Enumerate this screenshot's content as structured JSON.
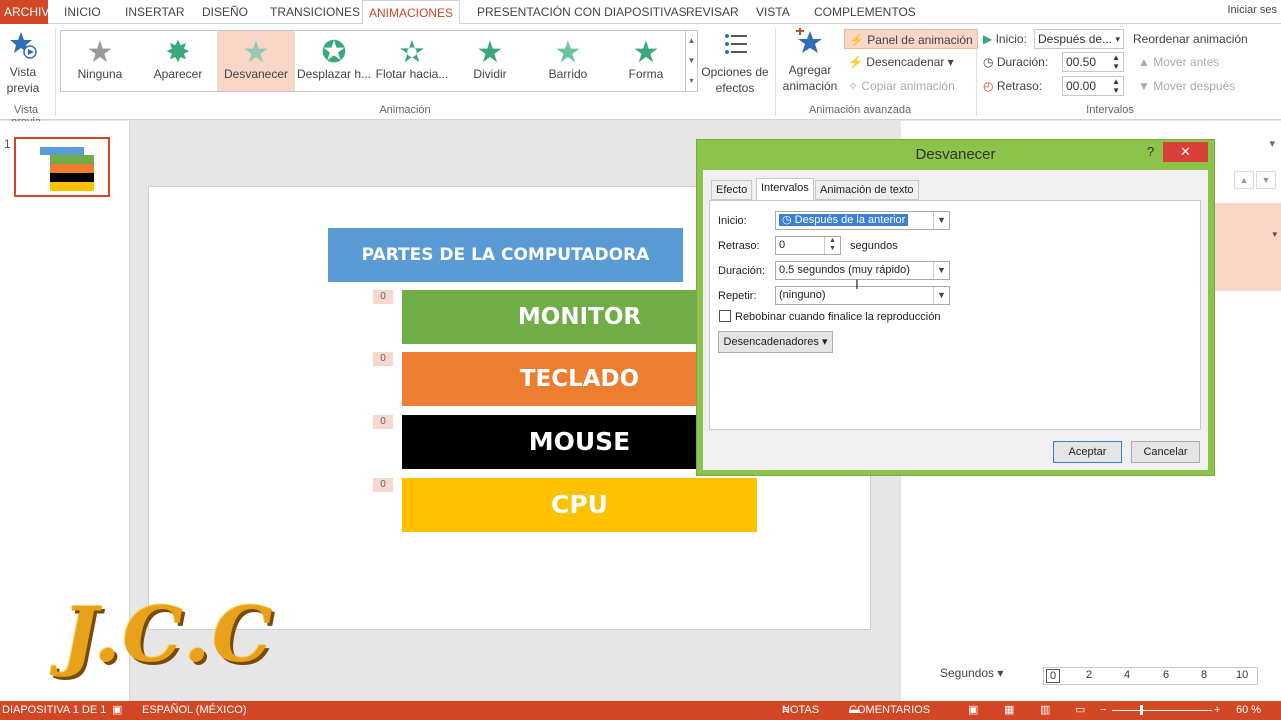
{
  "tabs": [
    "ARCHIVO",
    "INICIO",
    "INSERTAR",
    "DISEÑO",
    "TRANSICIONES",
    "ANIMACIONES",
    "PRESENTACIÓN CON DIAPOSITIVAS",
    "REVISAR",
    "VISTA",
    "COMPLEMENTOS"
  ],
  "signin": "Iniciar ses",
  "ribbon": {
    "preview_label_1": "Vista",
    "preview_label_2": "previa",
    "preview_group": "Vista previa",
    "gallery": [
      "Ninguna",
      "Aparecer",
      "Desvanecer",
      "Desplazar h...",
      "Flotar hacia...",
      "Dividir",
      "Barrido",
      "Forma"
    ],
    "effects_1": "Opciones de",
    "effects_2": "efectos",
    "anim_group": "Animación",
    "add_1": "Agregar",
    "add_2": "animación",
    "panel": "Panel de animación",
    "trigger": "Desencadenar",
    "copy": "Copiar animación",
    "adv_group": "Animación avanzada",
    "start_label": "Inicio:",
    "start_value": "Después de...",
    "duration_label": "Duración:",
    "duration_value": "00.50",
    "delay_label": "Retraso:",
    "delay_value": "00.00",
    "reorder": "Reordenar animación",
    "move_before": "Mover antes",
    "move_after": "Mover después",
    "timing_group": "Intervalos"
  },
  "thumb_number": "1",
  "slide": {
    "title": "PARTES DE LA COMPUTADORA",
    "items": [
      "MONITOR",
      "TECLADO",
      "MOUSE",
      "CPU"
    ],
    "tags": [
      "0",
      "0",
      "0",
      "0"
    ]
  },
  "dialog": {
    "title": "Desvanecer",
    "help": "?",
    "close": "✕",
    "tabs": [
      "Efecto",
      "Intervalos",
      "Animación de texto"
    ],
    "start_label": "Inicio:",
    "start_value": "Después de la anterior",
    "delay_label": "Retraso:",
    "delay_value": "0",
    "delay_unit": "segundos",
    "duration_label": "Duración:",
    "duration_value": "0.5 segundos (muy rápido)",
    "repeat_label": "Repetir:",
    "repeat_value": "(ninguno)",
    "rewind_label": "Rebobinar cuando finalice la reproducción",
    "triggers": "Desencadenadores",
    "ok": "Aceptar",
    "cancel": "Cancelar"
  },
  "timeline": {
    "label": "Segundos",
    "ticks": [
      "0",
      "2",
      "4",
      "6",
      "8",
      "10"
    ]
  },
  "status": {
    "slide": "DIAPOSITIVA 1 DE 1",
    "lang": "ESPAÑOL (MÉXICO)",
    "notes": "NOTAS",
    "comments": "COMENTARIOS",
    "zoom": "60 %"
  },
  "watermark": "J.C.C",
  "colors": {
    "accent": "#d24726",
    "title_box": "#5b9bd5",
    "monitor": "#70ad47",
    "teclado": "#ed7d31",
    "mouse": "#000000",
    "cpu": "#ffc000",
    "dialog_frame": "#8cc34a"
  }
}
